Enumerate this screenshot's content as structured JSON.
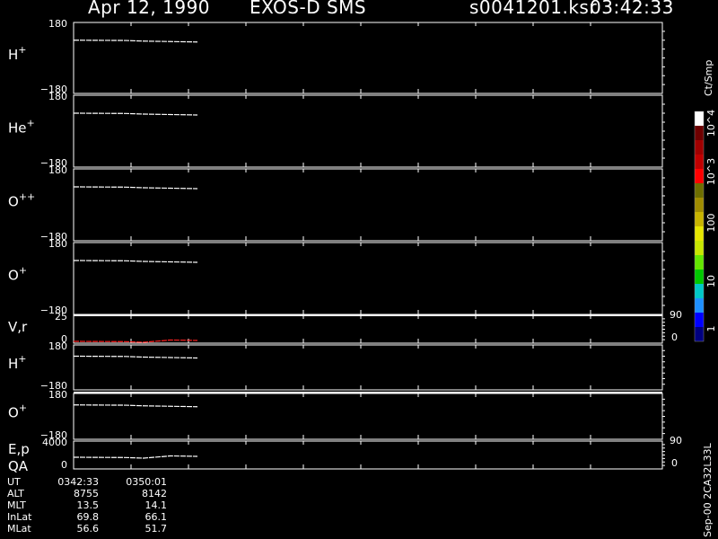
{
  "header": {
    "date": "Apr 12, 1990",
    "instrument": "EXOS-D SMS",
    "filename": "s0041201.ksr",
    "time": "03:42:33"
  },
  "colorbar": {
    "title": "Ct/Smp",
    "labels": [
      "1",
      "10",
      "100",
      "10^3",
      "10^4"
    ],
    "colors": [
      "#000080",
      "#0000ff",
      "#1e90ff",
      "#00c8c8",
      "#00c800",
      "#64e600",
      "#c8e600",
      "#e6e600",
      "#c8b400",
      "#a08c00",
      "#6e6e00",
      "#ff0000",
      "#c00000",
      "#a00000",
      "#6e0000",
      "#ffffff"
    ]
  },
  "side_id": "Sep-00  2CA32L33L",
  "panels": [
    {
      "name": "panel-h-plus",
      "label_base": "H",
      "label_sup": "+",
      "ytop": "180",
      "ybot": "−180"
    },
    {
      "name": "panel-he-plus",
      "label_base": "He",
      "label_sup": "+",
      "ytop": "180",
      "ybot": "−180"
    },
    {
      "name": "panel-o-plusplus",
      "label_base": "O",
      "label_sup": "++",
      "ytop": "180",
      "ybot": "−180"
    },
    {
      "name": "panel-o-plus",
      "label_base": "O",
      "label_sup": "+",
      "ytop": "180",
      "ybot": "−180"
    },
    {
      "name": "panel-vr",
      "label_base": "V,r",
      "label_sup": "",
      "ytop": "25",
      "ybot": "0",
      "rtop": "90",
      "rbot": "0"
    },
    {
      "name": "panel-h-plus-2",
      "label_base": "H",
      "label_sup": "+",
      "ytop": "180",
      "ybot": "−180"
    },
    {
      "name": "panel-o-plus-2",
      "label_base": "O",
      "label_sup": "+",
      "ytop": "180",
      "ybot": "−180"
    },
    {
      "name": "panel-ep-qa",
      "label_base": "E,p",
      "label_sup": "",
      "label2": "QA",
      "ytop": "4000",
      "ybot": "0",
      "rtop": "90",
      "rbot": "0"
    }
  ],
  "footer": {
    "rows": [
      {
        "label": "UT",
        "v1": "0342:33",
        "v2": "0350:01"
      },
      {
        "label": "ALT",
        "v1": "8755",
        "v2": "8142"
      },
      {
        "label": "MLT",
        "v1": "13.5",
        "v2": "14.1"
      },
      {
        "label": "InLat",
        "v1": "69.8",
        "v2": "66.1"
      },
      {
        "label": "MLat",
        "v1": "56.6",
        "v2": "51.7"
      }
    ]
  },
  "chart_data": {
    "type": "line",
    "trace_color": "#ffffff",
    "velocity_color": "#ff2020"
  }
}
